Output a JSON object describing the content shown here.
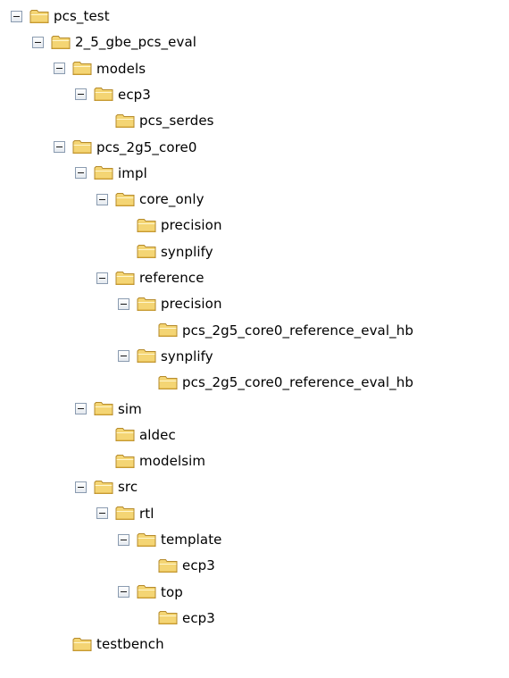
{
  "tree": {
    "expander_icon": "minus-box-icon",
    "folder_icon": "folder-icon",
    "colors": {
      "folder_fill": "#f4d574",
      "folder_border": "#b58a2a",
      "expander_border": "#8a9bb0"
    },
    "nodes": [
      {
        "id": "pcs_test",
        "label": "pcs_test",
        "depth": 0,
        "expanded": true
      },
      {
        "id": "2_5_gbe_pcs_eval",
        "label": "2_5_gbe_pcs_eval",
        "depth": 1,
        "expanded": true
      },
      {
        "id": "models",
        "label": "models",
        "depth": 2,
        "expanded": true
      },
      {
        "id": "ecp3-models",
        "label": "ecp3",
        "depth": 3,
        "expanded": true
      },
      {
        "id": "pcs_serdes",
        "label": "pcs_serdes",
        "depth": 4,
        "expanded": null
      },
      {
        "id": "pcs_2g5_core0",
        "label": "pcs_2g5_core0",
        "depth": 2,
        "expanded": true
      },
      {
        "id": "impl",
        "label": "impl",
        "depth": 3,
        "expanded": true
      },
      {
        "id": "core_only",
        "label": "core_only",
        "depth": 4,
        "expanded": true
      },
      {
        "id": "precision-core",
        "label": "precision",
        "depth": 5,
        "expanded": null
      },
      {
        "id": "synplify-core",
        "label": "synplify",
        "depth": 5,
        "expanded": null
      },
      {
        "id": "reference",
        "label": "reference",
        "depth": 4,
        "expanded": true
      },
      {
        "id": "precision-ref",
        "label": "precision",
        "depth": 5,
        "expanded": true
      },
      {
        "id": "ref-eval-hb-precision",
        "label": "pcs_2g5_core0_reference_eval_hb",
        "depth": 6,
        "expanded": null
      },
      {
        "id": "synplify-ref",
        "label": "synplify",
        "depth": 5,
        "expanded": true
      },
      {
        "id": "ref-eval-hb-synplify",
        "label": "pcs_2g5_core0_reference_eval_hb",
        "depth": 6,
        "expanded": null
      },
      {
        "id": "sim",
        "label": "sim",
        "depth": 3,
        "expanded": true
      },
      {
        "id": "aldec",
        "label": "aldec",
        "depth": 4,
        "expanded": null
      },
      {
        "id": "modelsim",
        "label": "modelsim",
        "depth": 4,
        "expanded": null
      },
      {
        "id": "src",
        "label": "src",
        "depth": 3,
        "expanded": true
      },
      {
        "id": "rtl",
        "label": "rtl",
        "depth": 4,
        "expanded": true
      },
      {
        "id": "template",
        "label": "template",
        "depth": 5,
        "expanded": true
      },
      {
        "id": "ecp3-template",
        "label": "ecp3",
        "depth": 6,
        "expanded": null
      },
      {
        "id": "top",
        "label": "top",
        "depth": 5,
        "expanded": true
      },
      {
        "id": "ecp3-top",
        "label": "ecp3",
        "depth": 6,
        "expanded": null
      },
      {
        "id": "testbench",
        "label": "testbench",
        "depth": 2,
        "expanded": null
      }
    ]
  }
}
